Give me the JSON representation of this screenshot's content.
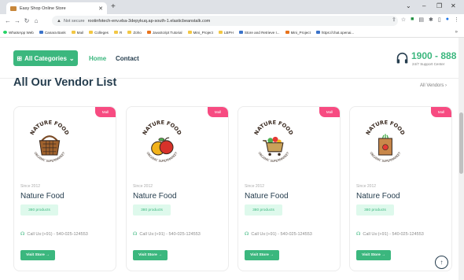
{
  "browser": {
    "tab_title": "Easy Shop Online Store",
    "url_warning": "Not secure",
    "url": "rootinfotech-env.eba-3depykuq.ap-south-1.elasticbeanstalk.com",
    "bookmarks": [
      "WhatsApp Web",
      "Canara Bank",
      "Mail",
      "Colleges",
      "R",
      "Zoho",
      "JavaScript Tutorial",
      "Mini_Project",
      "LBPH",
      "Store and Retrieve I...",
      "Mini_Project",
      "https://chat.openai..."
    ]
  },
  "nav": {
    "categories_label": "All Categories",
    "home": "Home",
    "contact": "Contact",
    "phone": "1900 - 888",
    "phone_sub": "24/7 Support Center"
  },
  "section": {
    "title": "All Our Vendor List",
    "all_vendors": "All Vendors"
  },
  "vendors": [
    {
      "badge": "Mall",
      "logo_top": "NATURE FOOD",
      "logo_bottom": "ORGANIC SUPERMARKET",
      "since": "Since 2012",
      "name": "Nature Food",
      "products": "380 products",
      "call": "Call Us:(+91) - 540-025-124553",
      "visit": "Visit Store"
    },
    {
      "badge": "Mall",
      "logo_top": "NATURE FOOD",
      "logo_bottom": "ORGANIC SUPERMARKET",
      "since": "Since 2012",
      "name": "Nature Food",
      "products": "380 products",
      "call": "Call Us:(+91) - 540-025-124553",
      "visit": "Visit Store"
    },
    {
      "badge": "Mall",
      "logo_top": "NATURE FOOD",
      "logo_bottom": "ORGANIC SUPERMARKET",
      "since": "Since 2012",
      "name": "Nature Food",
      "products": "380 products",
      "call": "Call Us:(+91) - 540-025-124553",
      "visit": "Visit Store"
    },
    {
      "badge": "Mall",
      "logo_top": "NATURE FOOD",
      "logo_bottom": "ORGANIC SUPERMARKET",
      "since": "Since 2012",
      "name": "Nature Food",
      "products": "380 products",
      "call": "Call Us:(+91) - 540-025-124553",
      "visit": "Visit Store"
    }
  ],
  "colors": {
    "accent": "#3bb77e",
    "badge": "#f74b81",
    "heading": "#253d4e"
  }
}
